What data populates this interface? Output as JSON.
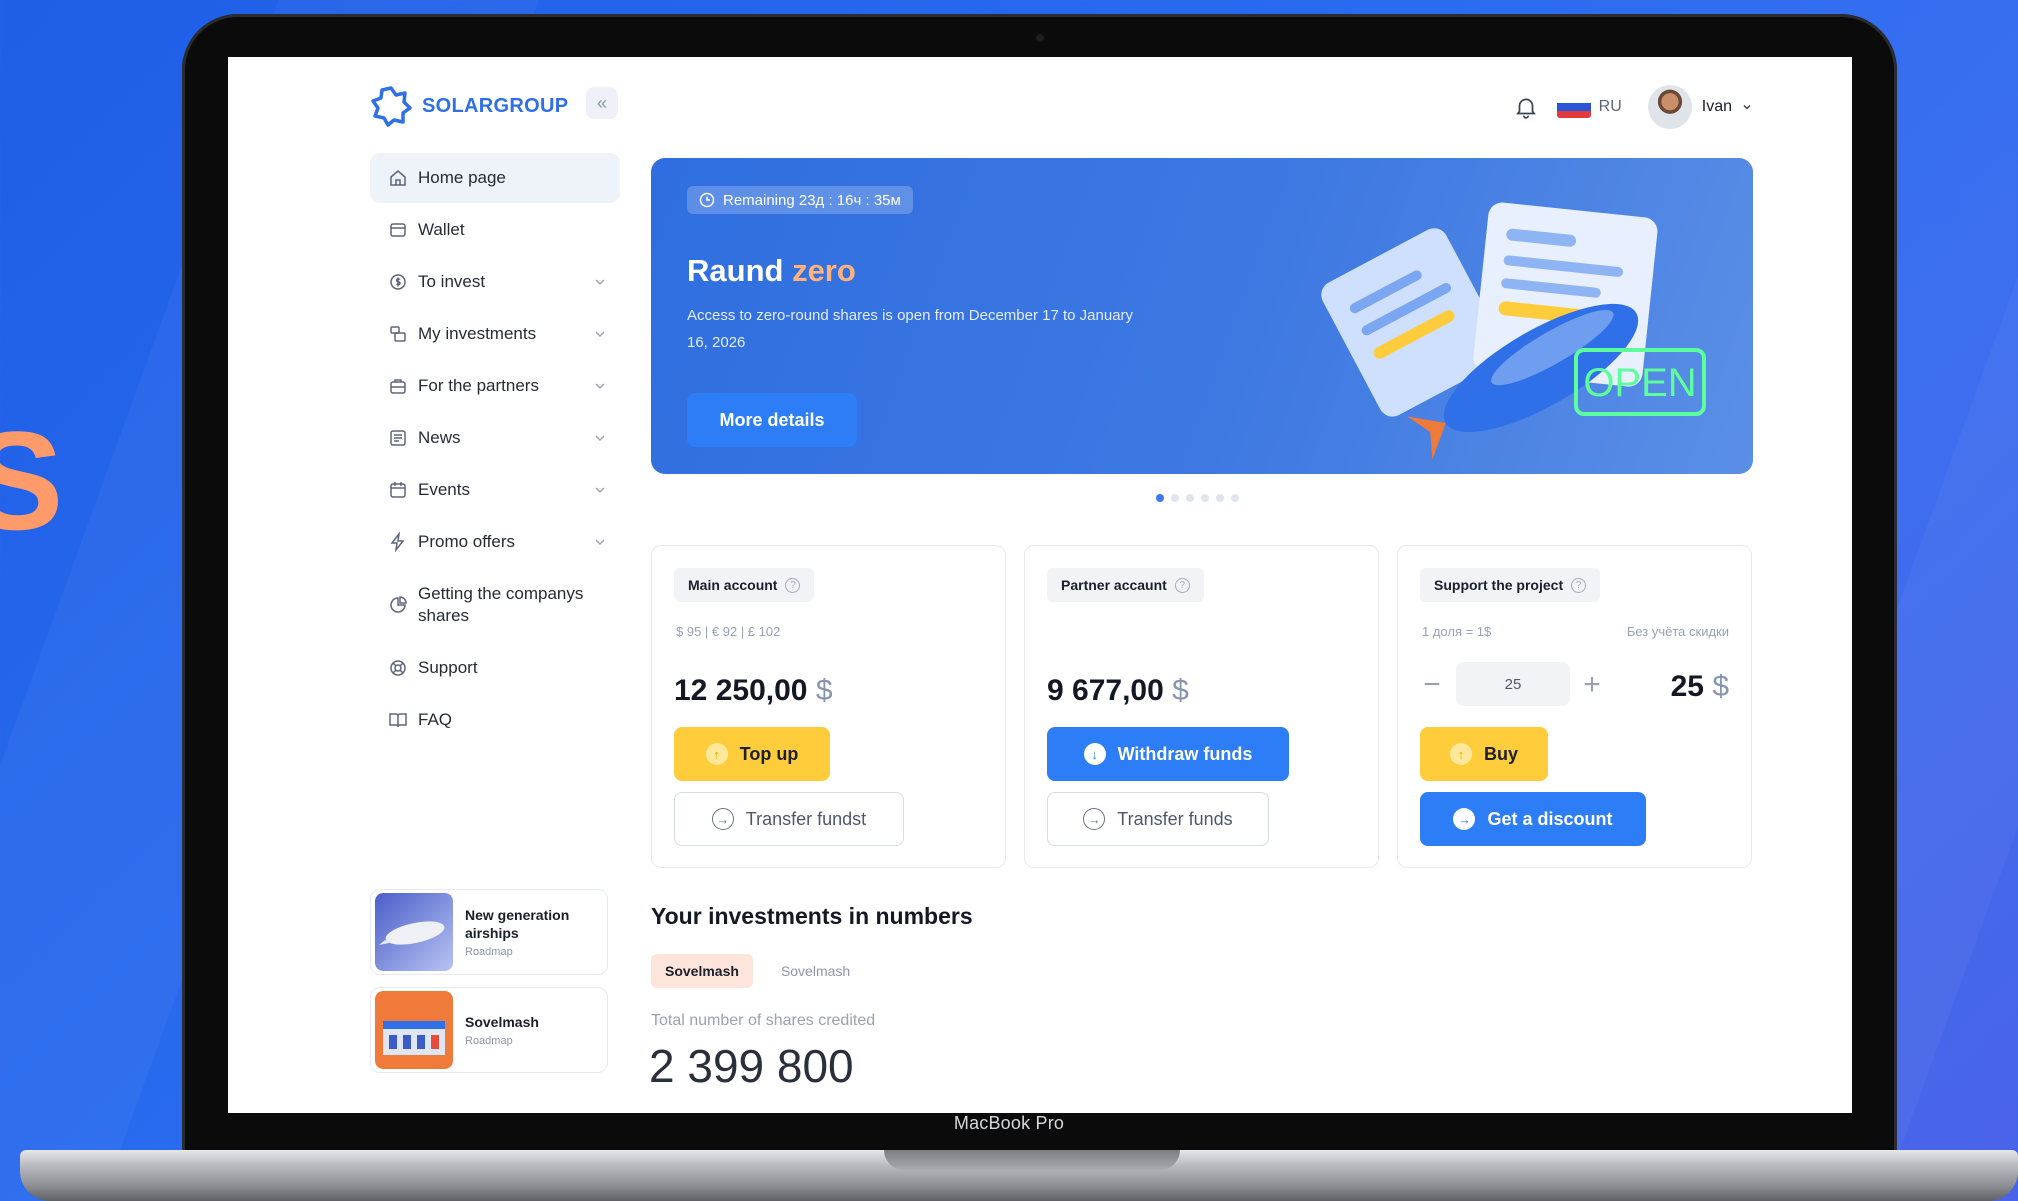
{
  "brand": {
    "name": "SOLARGROUP",
    "accent": "#2f6fe8"
  },
  "topbar": {
    "language": "RU",
    "user_name": "Ivan",
    "collapse_icon": "double-chevron-left-icon"
  },
  "sidebar": {
    "items": [
      {
        "label": "Home page",
        "icon": "home-icon",
        "active": true
      },
      {
        "label": "Wallet",
        "icon": "wallet-icon"
      },
      {
        "label": "To invest",
        "icon": "coin-icon",
        "expandable": true
      },
      {
        "label": "My investments",
        "icon": "investments-icon",
        "expandable": true
      },
      {
        "label": "For the partners",
        "icon": "partners-icon",
        "expandable": true
      },
      {
        "label": "News",
        "icon": "news-icon",
        "expandable": true
      },
      {
        "label": "Events",
        "icon": "calendar-icon",
        "expandable": true
      },
      {
        "label": "Promo offers",
        "icon": "lightning-icon",
        "expandable": true
      },
      {
        "label": "Getting the companys shares",
        "icon": "pie-chart-icon"
      },
      {
        "label": "Support",
        "icon": "lifebuoy-icon"
      },
      {
        "label": "FAQ",
        "icon": "book-icon"
      }
    ],
    "promos": [
      {
        "title": "New generation airships",
        "subtitle": "Roadmap"
      },
      {
        "title": "Sovelmash",
        "subtitle": "Roadmap"
      }
    ]
  },
  "banner": {
    "timer": "Remaining 23д : 16ч : 35м",
    "title_main": "Raund",
    "title_accent": "zero",
    "description": "Access to zero-round shares is open from December 17 to January 16, 2026",
    "button": "More details",
    "sign_text": "OPEN",
    "slides": 6,
    "active_slide": 1
  },
  "cards": {
    "main": {
      "label": "Main account",
      "sub": "$ 95 | € 92 | £ 102",
      "amount": "12 250,00",
      "currency": "$",
      "primary_button": "Top up",
      "secondary_button": "Transfer fundst"
    },
    "partner": {
      "label": "Partner accaunt",
      "amount": "9 677,00",
      "currency": "$",
      "primary_button": "Withdraw funds",
      "secondary_button": "Transfer funds"
    },
    "support": {
      "label": "Support the project",
      "sub_left": "1 доля = 1$",
      "sub_right": "Без учёта скидки",
      "quantity": "25",
      "amount": "25",
      "currency": "$",
      "primary_button": "Buy",
      "secondary_button": "Get a discount"
    }
  },
  "investments": {
    "title": "Your investments in numbers",
    "tabs": [
      "Sovelmash",
      "Sovelmash"
    ],
    "total_label": "Total number of shares credited",
    "total_value": "2 399 800"
  },
  "device_label": "MacBook Pro"
}
